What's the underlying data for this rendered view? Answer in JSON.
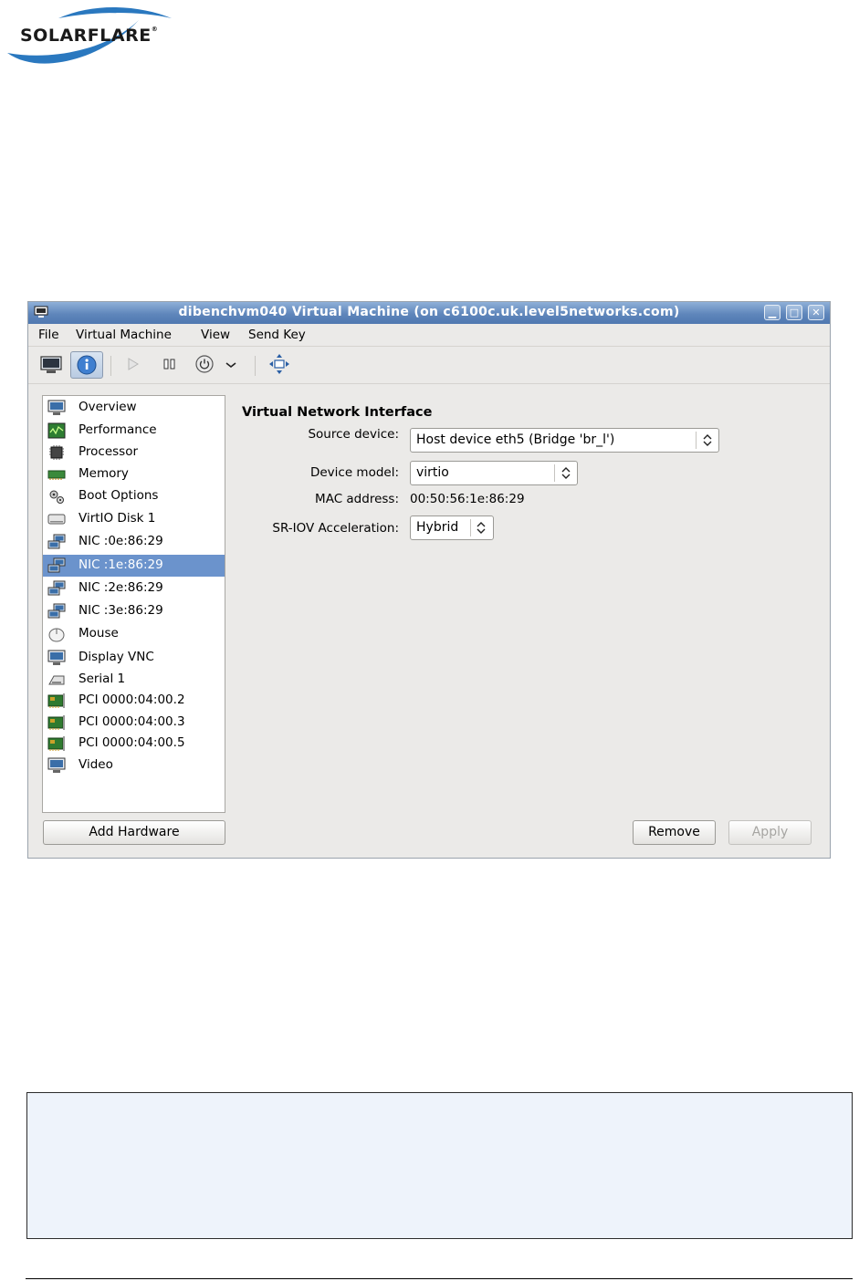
{
  "logo": {
    "text": "SOLARFLARE",
    "mark": "®"
  },
  "window": {
    "title": "dibenchvm040 Virtual Machine (on c6100c.uk.level5networks.com)",
    "controls": [
      "minimize-icon",
      "maximize-icon",
      "close-icon"
    ]
  },
  "menubar": {
    "items": [
      "File",
      "Virtual Machine",
      "View",
      "Send Key"
    ]
  },
  "toolbar": {
    "buttons": [
      "console-icon",
      "info-icon",
      "run-icon",
      "pause-icon",
      "power-icon",
      "chevron-down-icon",
      "fullscreen-icon"
    ],
    "active": "info-icon"
  },
  "hardware": {
    "items": [
      {
        "label": "Overview",
        "icon": "monitor-icon"
      },
      {
        "label": "Performance",
        "icon": "performance-icon"
      },
      {
        "label": "Processor",
        "icon": "processor-icon"
      },
      {
        "label": "Memory",
        "icon": "memory-icon"
      },
      {
        "label": "Boot Options",
        "icon": "gears-icon"
      },
      {
        "label": "VirtIO Disk 1",
        "icon": "disk-icon"
      },
      {
        "label": "NIC :0e:86:29",
        "icon": "network-icon"
      },
      {
        "label": "NIC :1e:86:29",
        "icon": "network-icon"
      },
      {
        "label": "NIC :2e:86:29",
        "icon": "network-icon"
      },
      {
        "label": "NIC :3e:86:29",
        "icon": "network-icon"
      },
      {
        "label": "Mouse",
        "icon": "mouse-icon"
      },
      {
        "label": "Display VNC",
        "icon": "monitor-icon"
      },
      {
        "label": "Serial 1",
        "icon": "serial-icon"
      },
      {
        "label": "PCI 0000:04:00.2",
        "icon": "pci-card-icon"
      },
      {
        "label": "PCI 0000:04:00.3",
        "icon": "pci-card-icon"
      },
      {
        "label": "PCI 0000:04:00.5",
        "icon": "pci-card-icon"
      },
      {
        "label": "Video",
        "icon": "monitor-icon"
      }
    ],
    "selected": "NIC :1e:86:29"
  },
  "details": {
    "title": "Virtual Network Interface",
    "source_device_label": "Source device:",
    "source_device_value": "Host device eth5 (Bridge 'br_l')",
    "device_model_label": "Device model:",
    "device_model_value": "virtio",
    "mac_label": "MAC address:",
    "mac_value": "00:50:56:1e:86:29",
    "sriov_label": "SR-IOV Acceleration:",
    "sriov_value": "Hybrid"
  },
  "buttons": {
    "add_hardware": "Add Hardware",
    "remove": "Remove",
    "apply": "Apply"
  },
  "colors": {
    "selection": "#6b93cc",
    "titlebar": "#5f86bb",
    "note_background": "#eef3fb"
  }
}
